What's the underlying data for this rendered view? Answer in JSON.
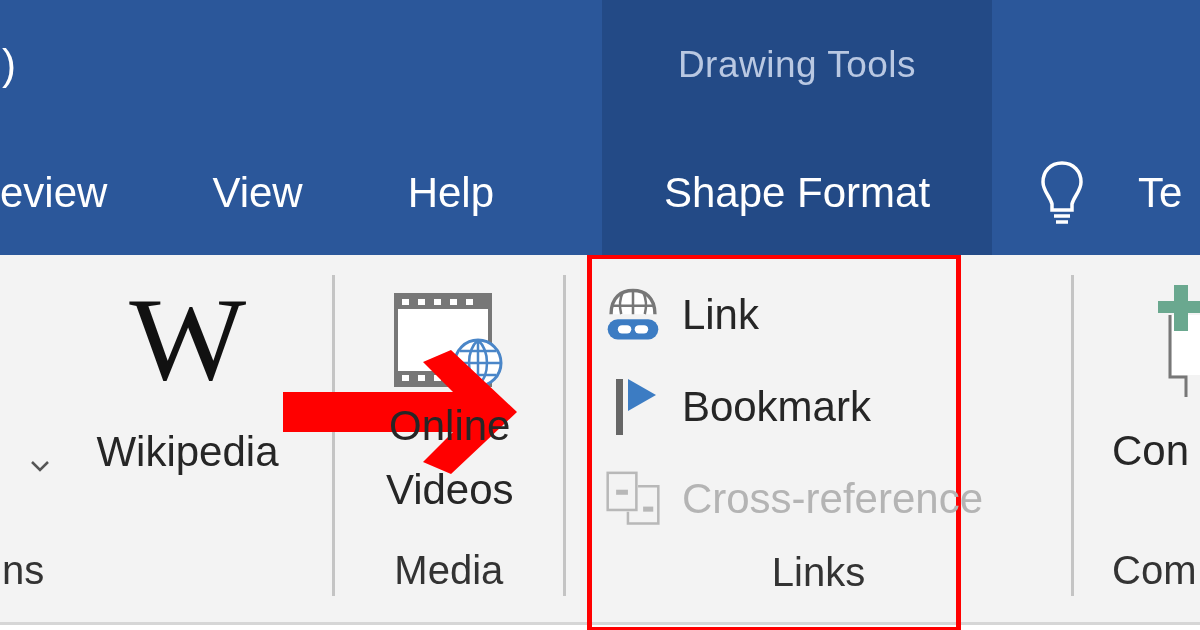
{
  "title_bar": {
    "title": ")"
  },
  "tabs": [
    {
      "label": "eview"
    },
    {
      "label": "View"
    },
    {
      "label": "Help"
    }
  ],
  "contextual_tab_group": {
    "title": "Drawing Tools",
    "tab": "Shape Format"
  },
  "tell_me": {
    "label": "Te"
  },
  "ribbon": {
    "groups": [
      {
        "kind": "addins",
        "label": "ns",
        "glyph": "W",
        "button": "Wikipedia"
      },
      {
        "kind": "media",
        "label": "Media",
        "button": "Online Videos"
      },
      {
        "kind": "links",
        "label": "Links",
        "items": [
          {
            "kind": "link",
            "label": "Link",
            "disabled": false
          },
          {
            "kind": "bookmark",
            "label": "Bookmark",
            "disabled": false
          },
          {
            "kind": "cross-reference",
            "label": "Cross-reference",
            "disabled": true
          }
        ]
      },
      {
        "kind": "comments",
        "label": "Com",
        "button": "Con"
      }
    ]
  }
}
